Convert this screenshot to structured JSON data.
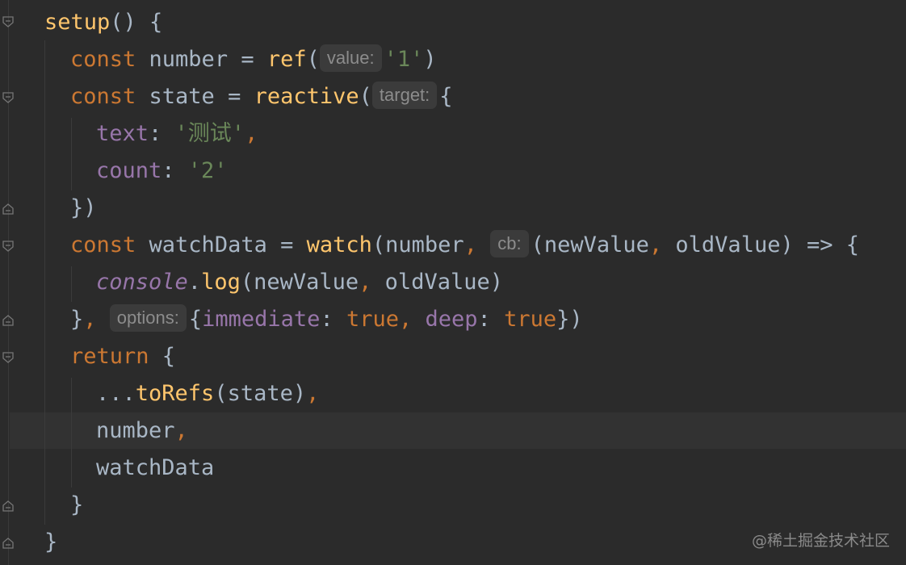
{
  "editor": {
    "inlay_hints": {
      "value": "value:",
      "target": "target:",
      "cb": "cb:",
      "options": "options:"
    },
    "lines": {
      "l1": {
        "fn": "setup",
        "rest": "() {"
      },
      "l2": {
        "kw": "const",
        "a": " number = ",
        "fn": "ref",
        "b": "(",
        "str": "'1'",
        "c": ")"
      },
      "l3": {
        "kw": "const",
        "a": " state = ",
        "fn": "reactive",
        "b": "(",
        "c": "{"
      },
      "l4": {
        "prop": "text",
        "a": ": ",
        "str": "'测试'",
        "kw": ","
      },
      "l5": {
        "prop": "count",
        "a": ": ",
        "str": "'2'"
      },
      "l6": {
        "text": "})"
      },
      "l7": {
        "kw": "const",
        "a": " watchData = ",
        "fn": "watch",
        "b": "(number",
        "kw2": ",",
        "c": " ",
        "d": "(newValue",
        "kw3": ",",
        "e": " oldValue) => {"
      },
      "l8": {
        "ital": "console",
        "a": ".",
        "fn": "log",
        "b": "(newValue",
        "kw": ",",
        "c": " oldValue)"
      },
      "l9": {
        "a": "}",
        "kw": ",",
        "c": " ",
        "d": "{",
        "prop1": "immediate",
        "e": ": ",
        "kw2": "true",
        "kw3": ",",
        "f": " ",
        "prop2": "deep",
        "g": ": ",
        "kw4": "true",
        "h": "})"
      },
      "l10": {
        "kw": "return",
        "a": " {"
      },
      "l11": {
        "a": "...",
        "fn": "toRefs",
        "b": "(state)",
        "kw": ","
      },
      "l12": {
        "a": "number",
        "kw": ","
      },
      "l13": {
        "a": "watchData"
      },
      "l14": {
        "a": "}"
      },
      "l15": {
        "a": "}"
      }
    }
  },
  "watermark": "@稀土掘金技术社区"
}
